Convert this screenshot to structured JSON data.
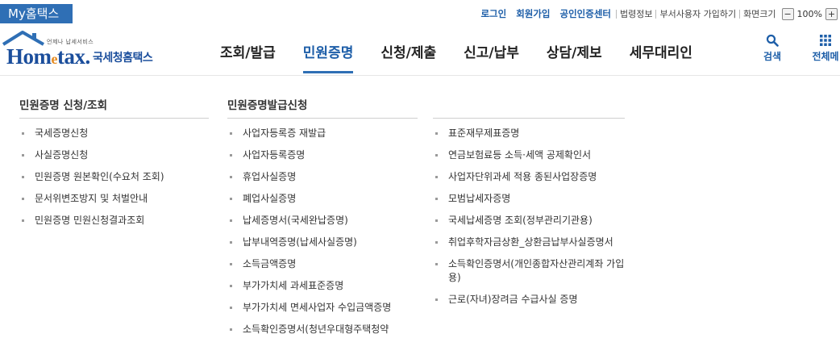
{
  "topbar": {
    "my_tab": "My홈택스",
    "links": [
      {
        "label": "로그인",
        "strong": true
      },
      {
        "label": "회원가입",
        "strong": true
      },
      {
        "label": "공인인증센터",
        "strong": true
      },
      {
        "label": "법령정보",
        "strong": false
      },
      {
        "label": "부서사용자 가입하기",
        "strong": false
      },
      {
        "label": "화면크기",
        "strong": false
      }
    ],
    "zoom": {
      "minus": "−",
      "value": "100%",
      "plus": "+"
    }
  },
  "logo": {
    "small_text": "언제나 납세서비스",
    "main_prefix": "Hom",
    "main_e": "e",
    "main_suffix": "tax.",
    "sub_text": "국세청홈택스"
  },
  "gnb": [
    {
      "label": "조회/발급",
      "active": false
    },
    {
      "label": "민원증명",
      "active": true
    },
    {
      "label": "신청/제출",
      "active": false
    },
    {
      "label": "신고/납부",
      "active": false
    },
    {
      "label": "상담/제보",
      "active": false
    },
    {
      "label": "세무대리인",
      "active": false
    }
  ],
  "tools": {
    "search": {
      "label": "검색",
      "icon": "search-icon"
    },
    "all_menu": {
      "label": "전체메",
      "icon": "grid-icon"
    }
  },
  "colors": {
    "brand": "#1d5ea8",
    "tab_bg": "#2f6fb5",
    "accent": "#e58a1f"
  },
  "dropdown": {
    "col1": {
      "title": "민원증명 신청/조회",
      "items": [
        "국세증명신청",
        "사실증명신청",
        "민원증명 원본확인(수요처 조회)",
        "문서위변조방지 및 처벌안내",
        "민원증명 민원신청결과조회"
      ]
    },
    "col2": {
      "title": "민원증명발급신청",
      "items": [
        "사업자등록증 재발급",
        "사업자등록증명",
        "휴업사실증명",
        "폐업사실증명",
        "납세증명서(국세완납증명)",
        "납부내역증명(납세사실증명)",
        "소득금액증명",
        "부가가치세 과세표준증명",
        "부가가치세 면세사업자 수입금액증명",
        "소득확인증명서(청년우대형주택청약"
      ]
    },
    "col3": {
      "items": [
        "표준재무제표증명",
        "연금보험료등 소득·세액 공제확인서",
        "사업자단위과세 적용 종된사업장증명",
        "모범납세자증명",
        "국세납세증명 조회(정부관리기관용)",
        "취업후학자금상환_상환금납부사실증명서",
        "소득확인증명서(개인종합자산관리계좌 가입용)",
        "근로(자녀)장려금 수급사실 증명"
      ]
    }
  }
}
